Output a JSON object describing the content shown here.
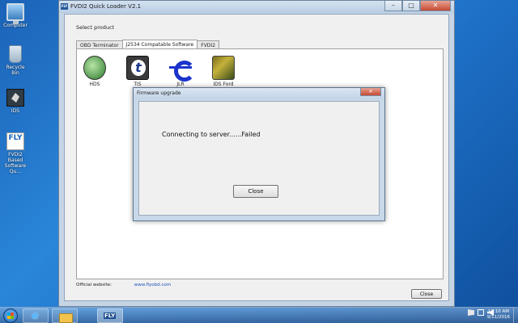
{
  "desktop": {
    "icons": [
      {
        "label": "Computer",
        "icon": "computer-icon"
      },
      {
        "label": "Recycle Bin",
        "icon": "recycle-bin-icon"
      },
      {
        "label": "IDS",
        "icon": "ids-icon"
      },
      {
        "label": "FVDI2 Based Software Qu...",
        "icon": "fly-icon"
      }
    ]
  },
  "main_window": {
    "title": "FVDI2 Quick Loader V2.1",
    "app_icon_text": "FLY",
    "select_product_label": "Select product",
    "tabs": [
      {
        "label": "OBD Terminator",
        "active": false
      },
      {
        "label": "J2534 Compatable Software",
        "active": true
      },
      {
        "label": "FVDI2",
        "active": false
      }
    ],
    "products": [
      {
        "label": "HDS",
        "icon": "hds-icon"
      },
      {
        "label": "TIS",
        "icon": "tis-icon"
      },
      {
        "label": "JLR",
        "icon": "jlr-icon"
      },
      {
        "label": "IDS Ford",
        "icon": "ids-ford-icon"
      }
    ],
    "official_website_label": "Official website:",
    "official_website_link": "www.flyobd.com",
    "close_button": "Close",
    "controls": {
      "minimize": "–",
      "maximize": "□",
      "close": "✕"
    }
  },
  "dialog": {
    "title": "Firmware upgrade",
    "message": "Connecting to server......Failed",
    "close_button": "Close",
    "close_glyph": "✕"
  },
  "taskbar": {
    "pinned": [
      "ie-icon",
      "folder-icon",
      "fly-icon"
    ],
    "clock_time": "12:10 AM",
    "clock_date": "9/11/2016"
  }
}
